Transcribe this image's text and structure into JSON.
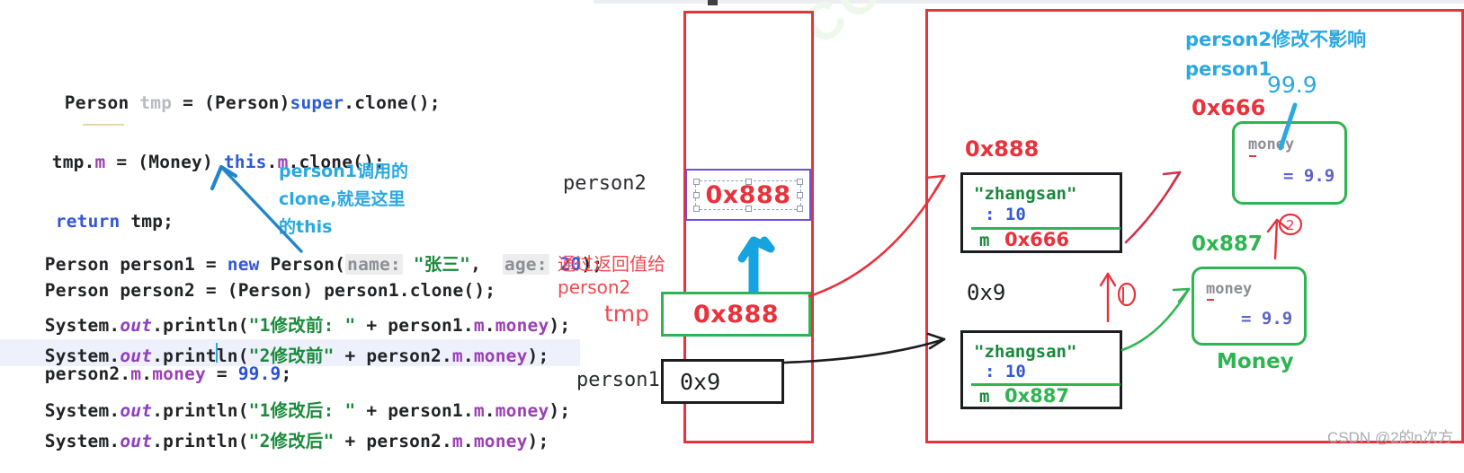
{
  "code": {
    "lines": [
      {
        "id": "l1",
        "text": "Person tmp = (Person)super.clone();"
      },
      {
        "id": "l2",
        "text": "tmp.m = (Money) this.m.clone();"
      },
      {
        "id": "l3",
        "text": "return tmp;"
      },
      {
        "id": "l4",
        "text": "Person person1 = new Person( name: \"张三\",  age: 20);"
      },
      {
        "id": "l5",
        "text": "Person person2 = (Person) person1.clone();"
      },
      {
        "id": "l6",
        "text": "System.out.println(\"1修改前: \" + person1.m.money);"
      },
      {
        "id": "l7",
        "text": "System.out.println(\"2修改前\" + person2.m.money);"
      },
      {
        "id": "l8",
        "text": "person2.m.money = 99.9;"
      },
      {
        "id": "l9",
        "text": "System.out.println(\"1修改后: \" + person1.m.money);"
      },
      {
        "id": "l10",
        "text": "System.out.println(\"2修改后\" + person2.m.money);"
      }
    ],
    "tokens": {
      "kw_person": "Person",
      "kw_tmp": "tmp",
      "kw_super": "super",
      "kw_this": "this",
      "kw_new": "new",
      "kw_return": "return",
      "kw_money_type": "Money",
      "hint_name": "name:",
      "hint_age": "age:",
      "str_zhangsan": "\"张三\"",
      "num_20": "20",
      "num_999": "99.9",
      "field_m": "m",
      "field_money": "money",
      "out": "out",
      "str_1_before": "\"1修改前: \"",
      "str_2_before": "\"2修改前\"",
      "str_1_after": "\"1修改后: \"",
      "str_2_after": "\"2修改后\""
    }
  },
  "annotations": {
    "blue_note_line1": "person1调用的",
    "blue_note_line2": "clone,就是这里",
    "blue_note_line3": "的this",
    "red_note_line1": "通过返回值给",
    "red_note_line2": "person2",
    "blue_heap_note_line1": "person2修改不影响",
    "blue_heap_note_line2": "person1",
    "blue_99": "99.9",
    "circle_one": "①",
    "circle_two": "②"
  },
  "stack": {
    "title_person2": "person2",
    "title_tmp": "tmp",
    "title_person1": "person1",
    "slot_person2_value": "0x888",
    "slot_tmp_value": "0x888",
    "slot_person1_value": "0x9"
  },
  "heap": {
    "person_obj_a": {
      "address_tag": "0x888",
      "name_value": "\"zhangsan\"",
      "age_value": ": 10",
      "m_label": "m",
      "m_value": "0x666"
    },
    "person_obj_b": {
      "address_tag": "0x9",
      "name_value": "\"zhangsan\"",
      "age_value": ": 10",
      "m_label": "m",
      "m_value": "0x887"
    },
    "money_obj_a": {
      "address_tag": "0x666",
      "field_name": "money",
      "field_value": "= 9.9"
    },
    "money_obj_b": {
      "address_tag": "0x887",
      "field_name": "money",
      "field_value": "= 9.9",
      "caption": "Money"
    }
  },
  "watermarks": {
    "diagonal": "COWYLRU",
    "corner": "CSDN @2的n次方"
  },
  "colors": {
    "red_container": "#e8323c",
    "green_accent": "#2eb551",
    "blue_annotation": "#2aa9e0",
    "purple_slot": "#6b4fd8",
    "black_box": "#1b1d20"
  }
}
